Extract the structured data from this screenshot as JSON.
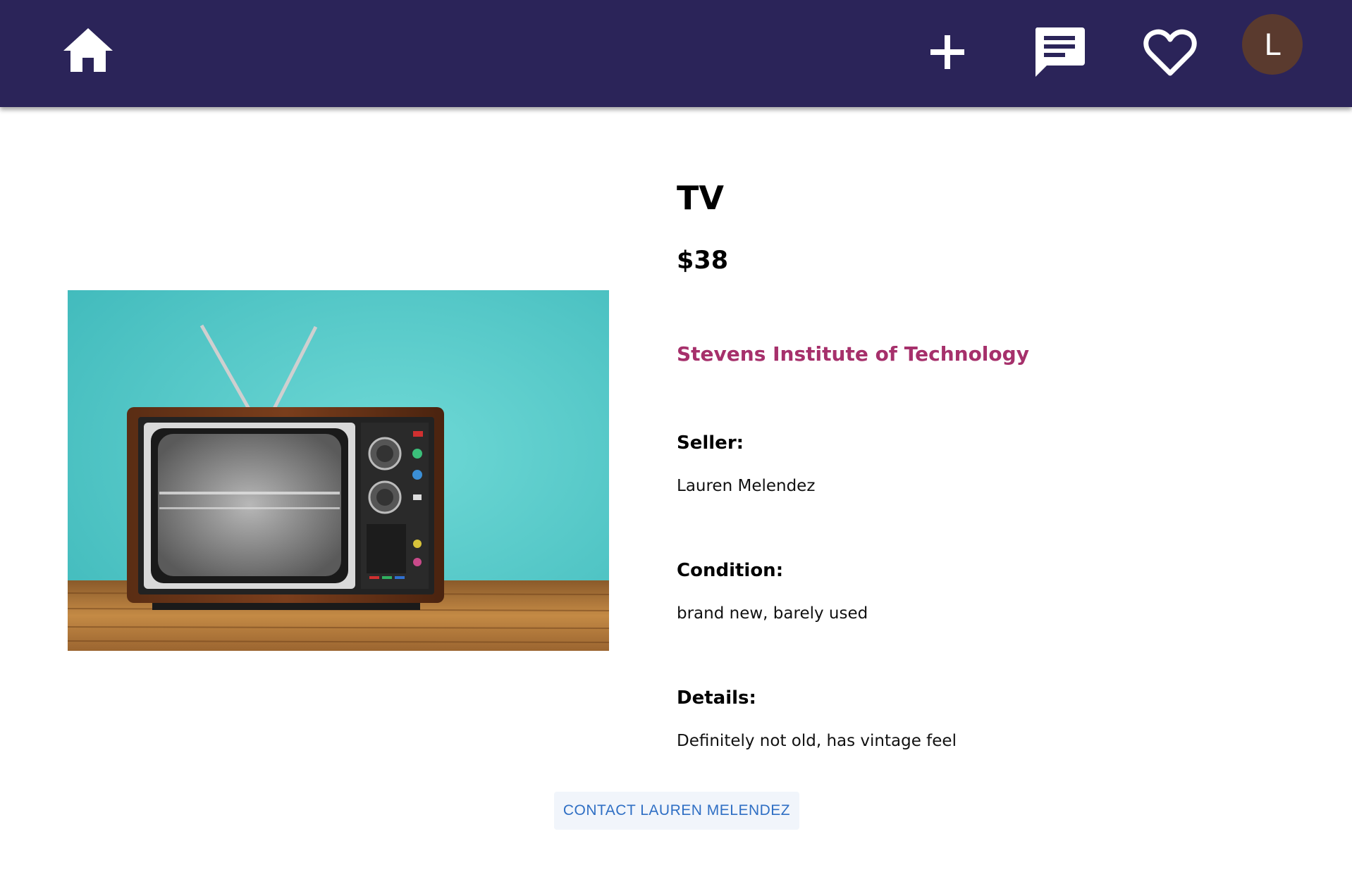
{
  "navbar": {
    "background": "#2b2459",
    "home_icon": "home-icon",
    "add_icon": "plus-icon",
    "messages_icon": "chat-icon",
    "favorites_icon": "heart-icon",
    "avatar_initial": "L",
    "avatar_color": "#5a3a2e"
  },
  "listing": {
    "title": "TV",
    "price": "$38",
    "school": "Stevens Institute of Technology",
    "school_color": "#a6306b",
    "seller_label": "Seller:",
    "seller_name": "Lauren Melendez",
    "condition_label": "Condition:",
    "condition_value": "brand new, barely used",
    "details_label": "Details:",
    "details_value": "Definitely not old, has vintage feel",
    "contact_button": "CONTACT LAUREN MELENDEZ",
    "image_subject": "vintage television with antennas on wooden table, teal background"
  }
}
